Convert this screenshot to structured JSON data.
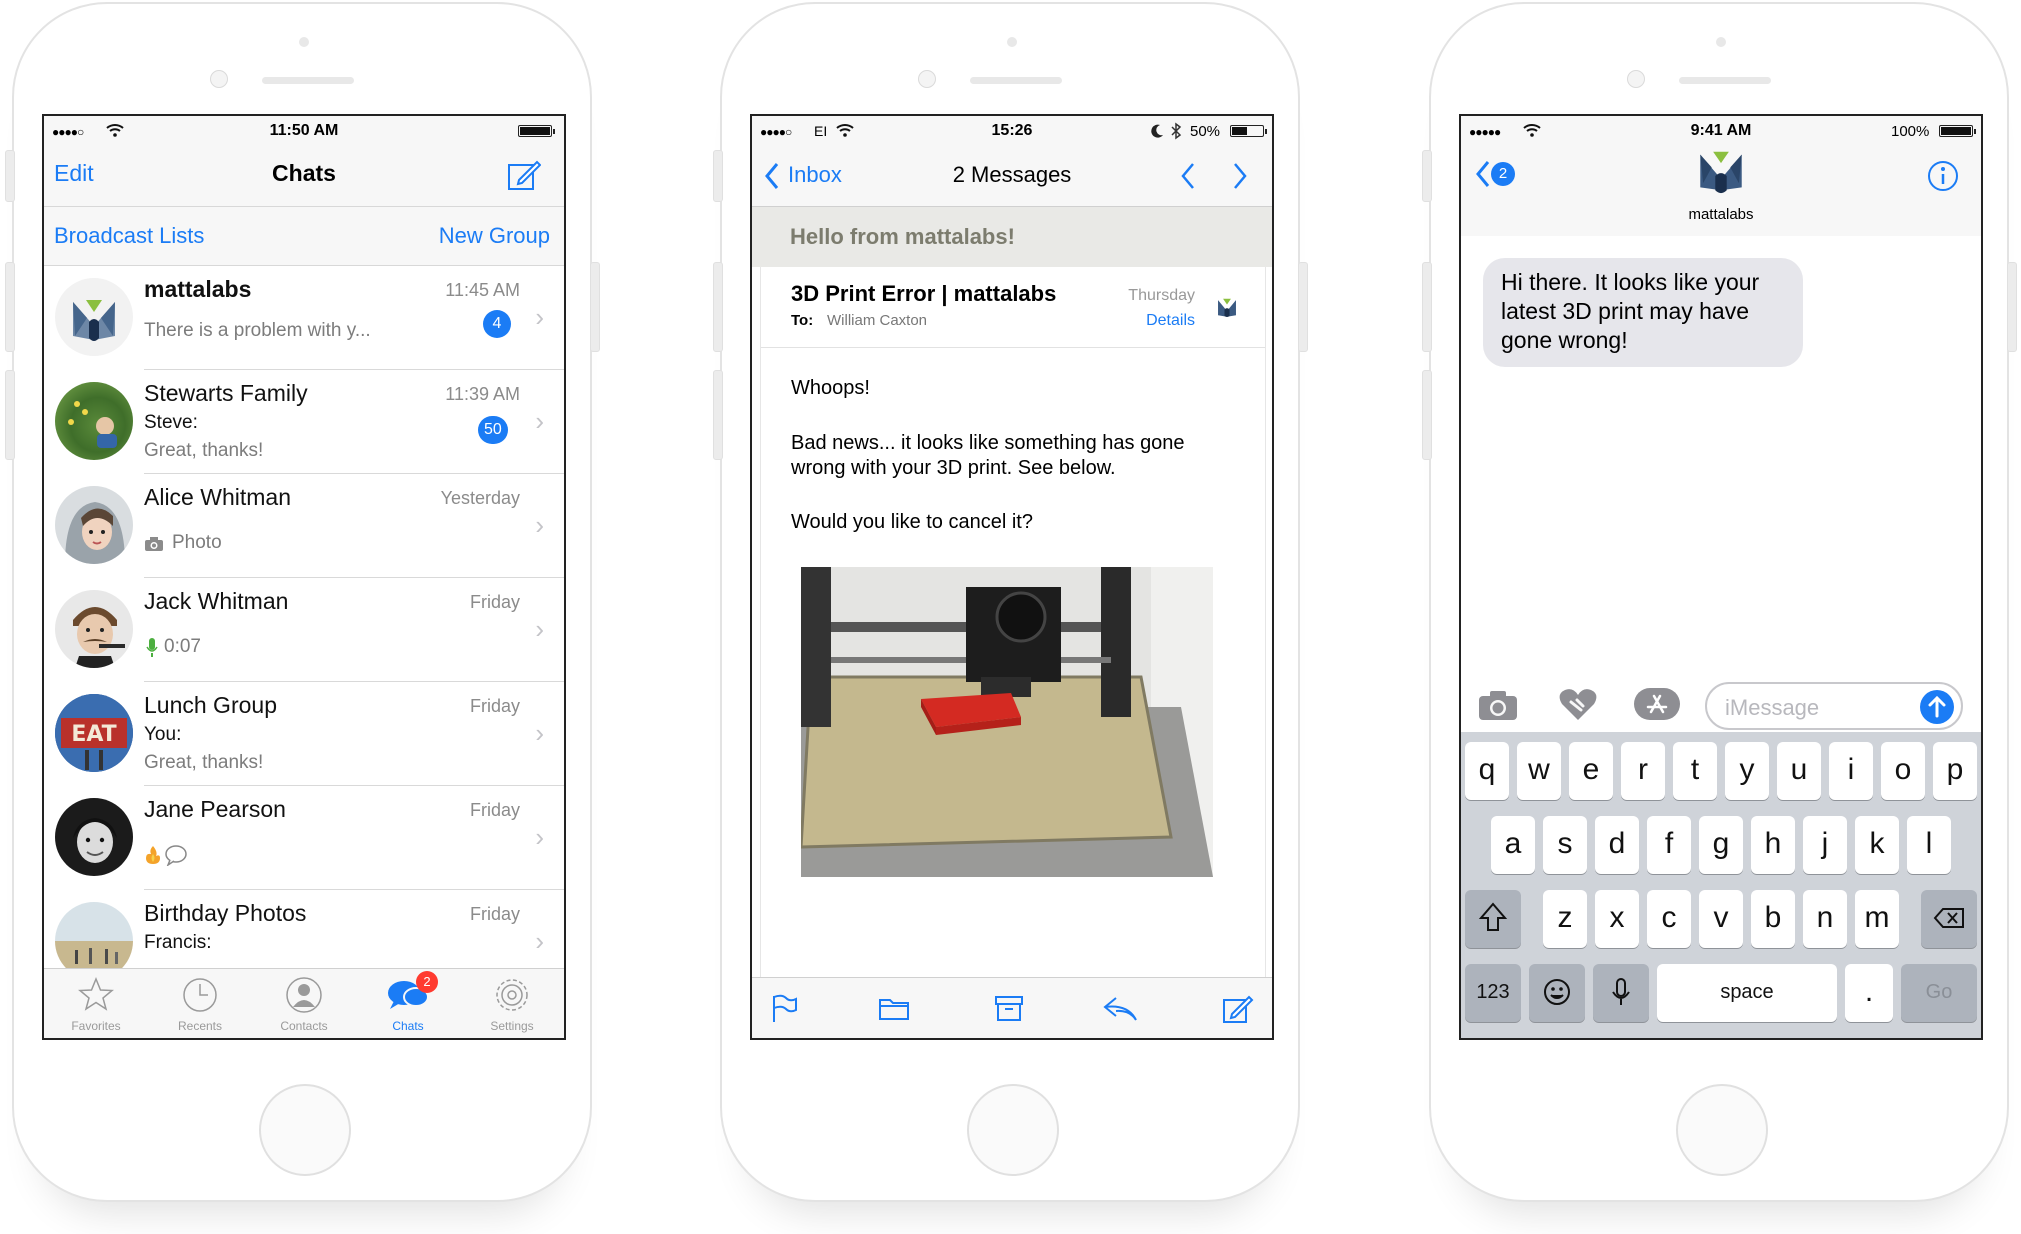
{
  "phone1": {
    "status": {
      "time": "11:50 AM"
    },
    "nav": {
      "edit": "Edit",
      "title": "Chats"
    },
    "subnav": {
      "broadcast": "Broadcast Lists",
      "new_group": "New Group"
    },
    "chats": [
      {
        "name": "mattalabs",
        "time": "11:45 AM",
        "line1": "There is a problem with y...",
        "line2": "",
        "badge": "4"
      },
      {
        "name": "Stewarts Family",
        "time": "11:39 AM",
        "line1": "Steve:",
        "line2": "Great, thanks!",
        "badge": "50"
      },
      {
        "name": "Alice Whitman",
        "time": "Yesterday",
        "line1": "Photo",
        "line2": "",
        "badge": ""
      },
      {
        "name": "Jack Whitman",
        "time": "Friday",
        "line1": "0:07",
        "line2": "",
        "badge": ""
      },
      {
        "name": "Lunch Group",
        "time": "Friday",
        "line1": "You:",
        "line2": "Great, thanks!",
        "badge": ""
      },
      {
        "name": "Jane Pearson",
        "time": "Friday",
        "line1": "",
        "line2": "",
        "badge": ""
      },
      {
        "name": "Birthday Photos",
        "time": "Friday",
        "line1": "Francis:",
        "line2": "",
        "badge": ""
      }
    ],
    "tabs": [
      {
        "label": "Favorites",
        "icon": "star-icon"
      },
      {
        "label": "Recents",
        "icon": "clock-icon"
      },
      {
        "label": "Contacts",
        "icon": "person-icon"
      },
      {
        "label": "Chats",
        "icon": "chat-bubbles-icon",
        "badge": "2"
      },
      {
        "label": "Settings",
        "icon": "gear-icon"
      }
    ],
    "colors": {
      "accent": "#1b7cf5",
      "badge_red": "#ff3b30"
    }
  },
  "phone2": {
    "status": {
      "carrier": "EI",
      "time": "15:26",
      "battery": "50%"
    },
    "nav": {
      "back": "Inbox",
      "title": "2 Messages"
    },
    "banner": "Hello from mattalabs!",
    "header": {
      "subject": "3D Print Error | mattalabs",
      "to_label": "To:",
      "to": "William Caxton",
      "date": "Thursday",
      "details": "Details"
    },
    "body": [
      "Whoops!",
      "Bad news... it looks like something has gone wrong with your 3D print. See below.",
      "Would you like to cancel it?"
    ],
    "toolbar": [
      "flag-icon",
      "folder-icon",
      "archive-icon",
      "reply-icon",
      "compose-icon"
    ]
  },
  "phone3": {
    "status": {
      "time": "9:41 AM",
      "battery": "100%"
    },
    "nav": {
      "back_count": "2",
      "contact": "mattalabs"
    },
    "message": "Hi there. It looks like your latest 3D print may have gone wrong!",
    "input_placeholder": "iMessage",
    "keyboard": {
      "row1": [
        "q",
        "w",
        "e",
        "r",
        "t",
        "y",
        "u",
        "i",
        "o",
        "p"
      ],
      "row2": [
        "a",
        "s",
        "d",
        "f",
        "g",
        "h",
        "j",
        "k",
        "l"
      ],
      "row3": [
        "z",
        "x",
        "c",
        "v",
        "b",
        "n",
        "m"
      ],
      "numbers": "123",
      "space": "space",
      "period": ".",
      "go": "Go"
    }
  }
}
